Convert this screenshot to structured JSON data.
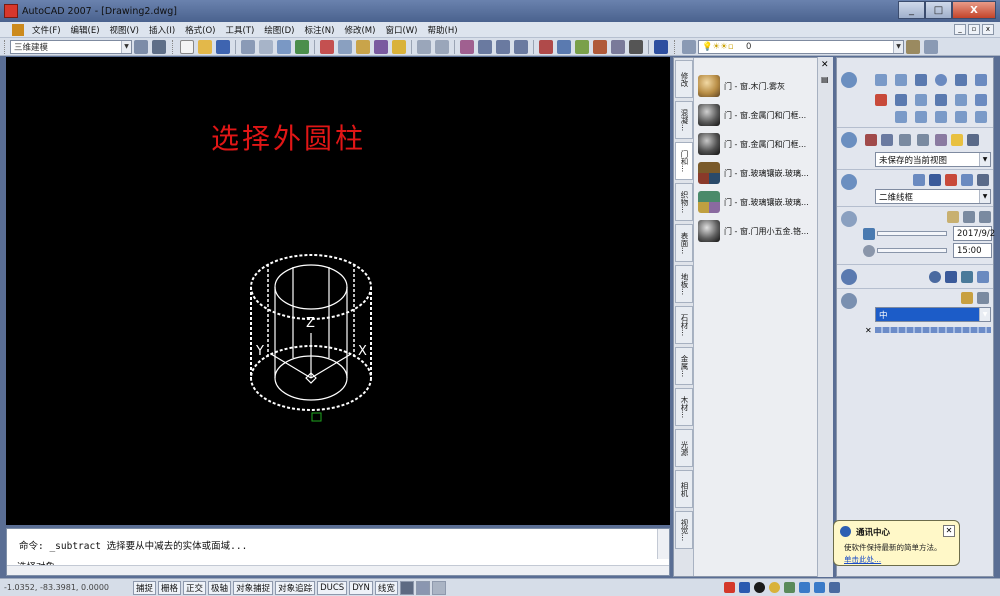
{
  "window": {
    "title": "AutoCAD 2007 - [Drawing2.dwg]",
    "controls": [
      "_",
      "□",
      "X"
    ]
  },
  "menu": {
    "items": [
      "文件(F)",
      "编辑(E)",
      "视图(V)",
      "插入(I)",
      "格式(O)",
      "工具(T)",
      "绘图(D)",
      "标注(N)",
      "修改(M)",
      "窗口(W)",
      "帮助(H)"
    ],
    "mdi_controls": [
      "_",
      "▫",
      "x"
    ]
  },
  "toolbar": {
    "workspace": "三维建模",
    "layer": "0"
  },
  "canvas": {
    "caption": "选择外圆柱",
    "axis_labels": {
      "z": "Z",
      "x": "X",
      "y": "Y"
    }
  },
  "command": {
    "history": "命令: _subtract 选择要从中减去的实体或面域...",
    "prompt": "选择对象:"
  },
  "status": {
    "coords": "-1.0352,  -83.3981, 0.0000",
    "buttons": [
      "捕捉",
      "栅格",
      "正交",
      "极轴",
      "对象捕捉",
      "对象追踪",
      "DUCS",
      "DYN",
      "线宽"
    ]
  },
  "palette": {
    "tabs": [
      "修改",
      "混凝...",
      "门和...",
      "织物...",
      "表面...",
      "地板...",
      "石材...",
      "金属...",
      "木材...",
      "光源",
      "相机",
      "视觉..."
    ],
    "active_tab": 2,
    "items": [
      {
        "label": "门 - 窗.木门.雾灰",
        "color": "#c8a060"
      },
      {
        "label": "门 - 窗.金属门和门框...",
        "color": "#2a2a2a"
      },
      {
        "label": "门 - 窗.金属门和门框...",
        "color": "#333333"
      },
      {
        "label": "门 - 窗.玻璃镶嵌.玻璃...",
        "color": "#5a4a3a"
      },
      {
        "label": "门 - 窗.玻璃镶嵌.玻璃...",
        "color": "#4a6a5a"
      },
      {
        "label": "门 - 窗.门用小五金.铬...",
        "color": "#3a3a3a"
      }
    ]
  },
  "dashboard": {
    "view": "未保存的当前视图",
    "visual_style": "二维线框",
    "date": "2017/9/2",
    "time": "15:00",
    "material": "中"
  },
  "tray": {
    "title": "通讯中心",
    "text": "使软件保持最新的简单方法。",
    "link": "单击此处..."
  }
}
